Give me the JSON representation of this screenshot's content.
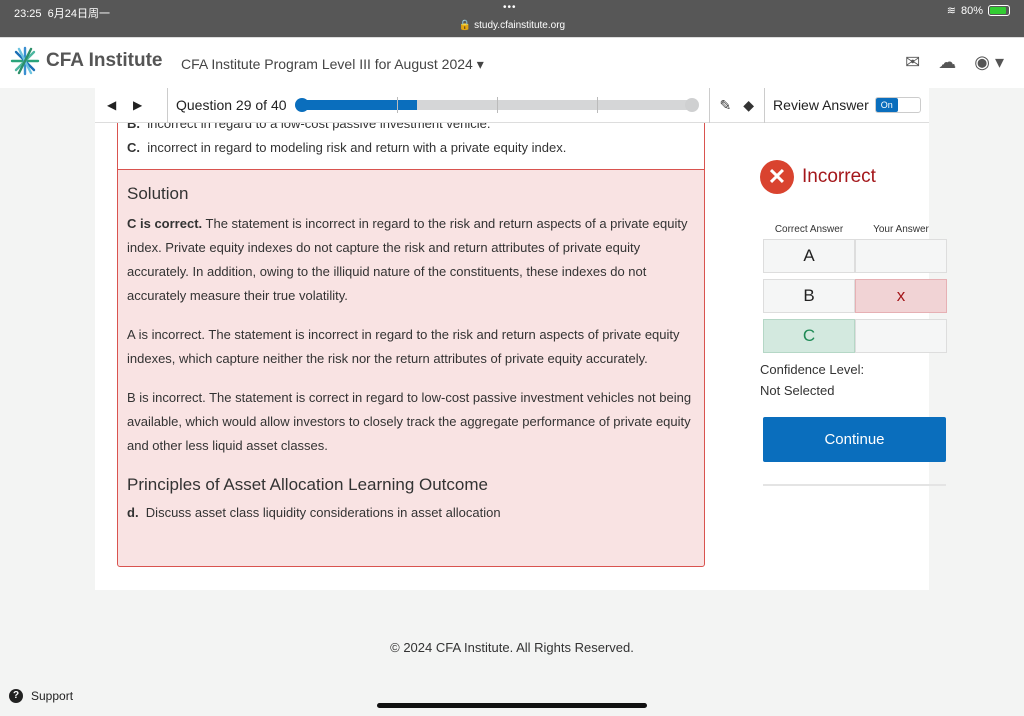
{
  "status": {
    "time": "23:25",
    "date": "6月24日周一",
    "url": "study.cfainstitute.org",
    "battery": "80%",
    "battery_level": 0.8
  },
  "header": {
    "logo": "CFA Institute",
    "program": "CFA Institute Program Level III for August 2024"
  },
  "toolbar": {
    "question": "Question 29 of 40",
    "progress_fraction": 0.3,
    "review_label": "Review Answer",
    "toggle": "On"
  },
  "question": {
    "options": [
      {
        "letter": "B.",
        "text": "incorrect in regard to a low-cost passive investment vehicle."
      },
      {
        "letter": "C.",
        "text": "incorrect in regard to modeling risk and return with a private equity index."
      }
    ]
  },
  "solution": {
    "title": "Solution",
    "p1_bold": "C is correct.",
    "p1": " The statement is incorrect in regard to the risk and return aspects of a private equity index. Private equity indexes do not capture the risk and return attributes of private equity accurately. In addition, owing to the illiquid nature of the constituents, these indexes do not accurately measure their true volatility.",
    "p2": "A is incorrect. The statement is incorrect in regard to the risk and return aspects of private equity indexes, which capture neither the risk nor the return attributes of private equity accurately.",
    "p3": "B is incorrect. The statement is correct in regard to low-cost passive investment vehicles not being available, which would allow investors to closely track the aggregate performance of private equity and other less liquid asset classes.",
    "lo_title": "Principles of Asset Allocation Learning Outcome",
    "lo_letter": "d.",
    "lo_text": "Discuss asset class liquidity considerations in asset allocation"
  },
  "result": {
    "status": "Incorrect",
    "col_correct": "Correct Answer",
    "col_yours": "Your Answer",
    "rows": [
      {
        "answer": "A",
        "mine": ""
      },
      {
        "answer": "B",
        "mine": "x"
      },
      {
        "answer": "C",
        "mine": ""
      }
    ],
    "confidence_label": "Confidence Level:",
    "confidence_value": "Not Selected",
    "continue": "Continue"
  },
  "footer": {
    "copyright": "© 2024 CFA Institute. All Rights Reserved.",
    "support": "Support"
  },
  "colors": {
    "accent": "#0a6ebd",
    "error": "#d9432f",
    "correct": "#d3e9df"
  }
}
